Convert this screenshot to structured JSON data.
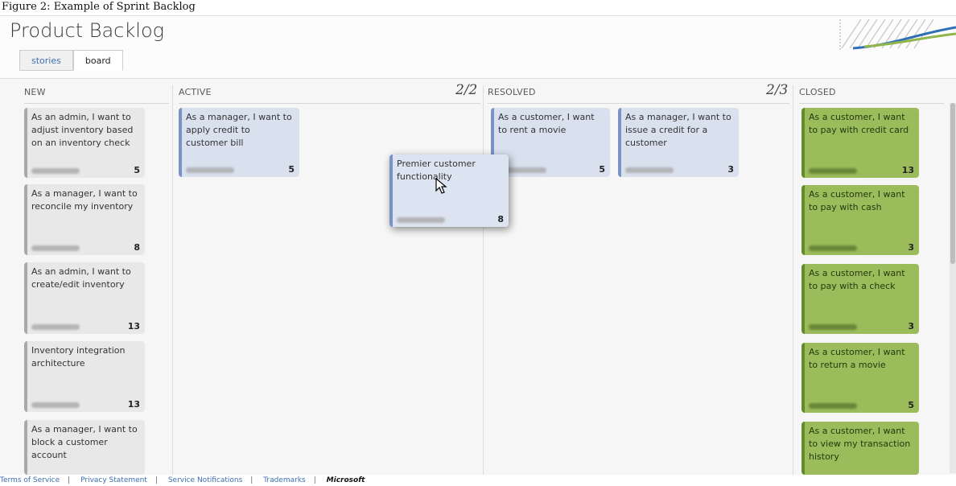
{
  "caption": "Figure 2: Example of Sprint Backlog",
  "header": {
    "title": "Product Backlog"
  },
  "tabs": [
    {
      "label": "stories"
    },
    {
      "label": "board"
    }
  ],
  "columns": {
    "new": {
      "name": "NEW",
      "cards": [
        {
          "text": "As an admin, I want to adjust inventory based on an inventory check",
          "points": "5"
        },
        {
          "text": "As a manager, I want to reconcile my inventory",
          "points": "8"
        },
        {
          "text": "As an admin, I want to create/edit inventory",
          "points": "13"
        },
        {
          "text": "Inventory integration architecture",
          "points": "13"
        },
        {
          "text": "As a manager, I want to block a customer account",
          "points": ""
        }
      ]
    },
    "active": {
      "name": "ACTIVE",
      "count": "2/2",
      "cards": [
        {
          "text": "As a manager, I want to apply credit to customer bill",
          "points": "5"
        }
      ]
    },
    "resolved": {
      "name": "RESOLVED",
      "count": "2/3",
      "cards": [
        {
          "text": "As a customer, I want to rent a movie",
          "points": "5"
        },
        {
          "text": "As a manager, I want to issue a credit for a customer",
          "points": "3"
        }
      ]
    },
    "closed": {
      "name": "CLOSED",
      "cards": [
        {
          "text": "As a customer, I want to pay with credit card",
          "points": "13"
        },
        {
          "text": "As a customer, I want to pay with cash",
          "points": "3"
        },
        {
          "text": "As a customer, I want to pay with a check",
          "points": "3"
        },
        {
          "text": "As a customer, I want to return a movie",
          "points": "5"
        },
        {
          "text": "As a customer, I want to view my transaction history",
          "points": ""
        }
      ]
    }
  },
  "dragged_card": {
    "text": "Premier customer functionality",
    "points": "8"
  },
  "footer": {
    "links": [
      "Terms of Service",
      "Privacy Statement",
      "Service Notifications",
      "Trademarks"
    ],
    "brand": "Microsoft"
  },
  "colors": {
    "new_card": "#e8e8e8",
    "active_card": "#d9e1ef",
    "closed_card": "#9cbb5b",
    "link": "#3c6eb4"
  }
}
